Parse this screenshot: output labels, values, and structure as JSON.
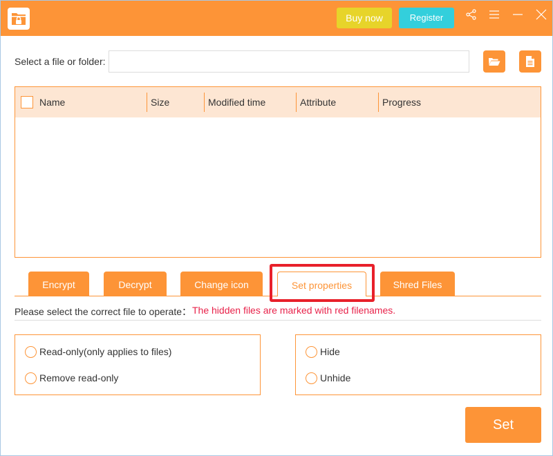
{
  "titlebar": {
    "app_icon": "folder-lock-icon",
    "buy_now_label": "Buy now",
    "register_label": "Register",
    "icons": [
      "share-icon",
      "menu-icon",
      "minimize-icon",
      "close-icon"
    ]
  },
  "file_select": {
    "label": "Select a file or folder:",
    "value": "",
    "placeholder": "",
    "open_folder_icon": "folder-open-icon",
    "open_file_icon": "file-icon"
  },
  "table": {
    "columns": [
      "Name",
      "Size",
      "Modified time",
      "Attribute",
      "Progress"
    ],
    "select_all_checked": false,
    "rows": []
  },
  "tabs": [
    {
      "label": "Encrypt",
      "active": false
    },
    {
      "label": "Decrypt",
      "active": false
    },
    {
      "label": "Change icon",
      "active": false
    },
    {
      "label": "Set properties",
      "active": true
    },
    {
      "label": "Shred Files",
      "active": false
    }
  ],
  "hint": {
    "text": "Please select the correct file to operate：",
    "warning": "The hidden files are marked with red filenames."
  },
  "options": {
    "readonly_group": [
      {
        "label": "Read-only(only applies to files)",
        "selected": false
      },
      {
        "label": "Remove read-only",
        "selected": false
      }
    ],
    "hidden_group": [
      {
        "label": "Hide",
        "selected": false
      },
      {
        "label": "Unhide",
        "selected": false
      }
    ]
  },
  "actions": {
    "set_label": "Set"
  },
  "colors": {
    "accent": "#fd9437",
    "buy_now": "#e7d42a",
    "register": "#33cfdc",
    "header_bg": "#fde6d3",
    "warning_text": "#e8224a",
    "highlight": "#e8202a"
  }
}
